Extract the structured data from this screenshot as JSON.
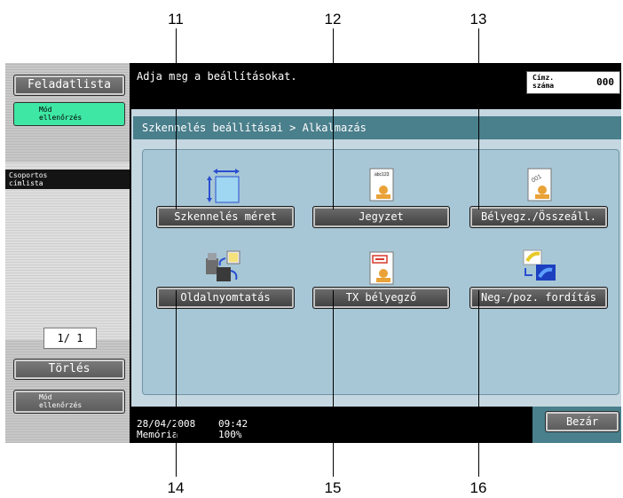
{
  "callouts": {
    "top": [
      "11",
      "12",
      "13"
    ],
    "bottom": [
      "14",
      "15",
      "16"
    ]
  },
  "sidebar": {
    "job_list": "Feladatlista",
    "mode_check_top_line1": "Mód",
    "mode_check_top_line2": "ellenőrzés",
    "group_list_line1": "Csoportos",
    "group_list_line2": "címlista",
    "page_indicator": "1/  1",
    "delete": "Törlés",
    "mode_check_bottom_line1": "Mód",
    "mode_check_bottom_line2": "ellenőrzés"
  },
  "header": {
    "message": "Adja meg a beállításokat.",
    "address_count_label_line1": "Címz.",
    "address_count_label_line2": "száma",
    "address_count_value": "000"
  },
  "breadcrumb": "Szkennelés beállításai > Alkalmazás",
  "functions": [
    {
      "label": "Szkennelés méret",
      "icon": "scan-size-icon"
    },
    {
      "label": "Jegyzet",
      "icon": "annotation-icon"
    },
    {
      "label": "Bélyegz./Összeáll.",
      "icon": "stamp-compose-icon"
    },
    {
      "label": "Oldalnyomtatás",
      "icon": "page-print-icon"
    },
    {
      "label": "TX bélyegző",
      "icon": "tx-stamp-icon"
    },
    {
      "label": "Neg-/poz. fordítás",
      "icon": "neg-pos-reverse-icon"
    }
  ],
  "status": {
    "date": "28/04/2008",
    "time": "09:42",
    "memory_label": "Memória",
    "memory_value": "100%"
  },
  "close": "Bezár",
  "colors": {
    "accent_green": "#3fe7a4",
    "breadcrumb_teal": "#4a7f8c",
    "panel_blue": "#a8c7d6"
  }
}
